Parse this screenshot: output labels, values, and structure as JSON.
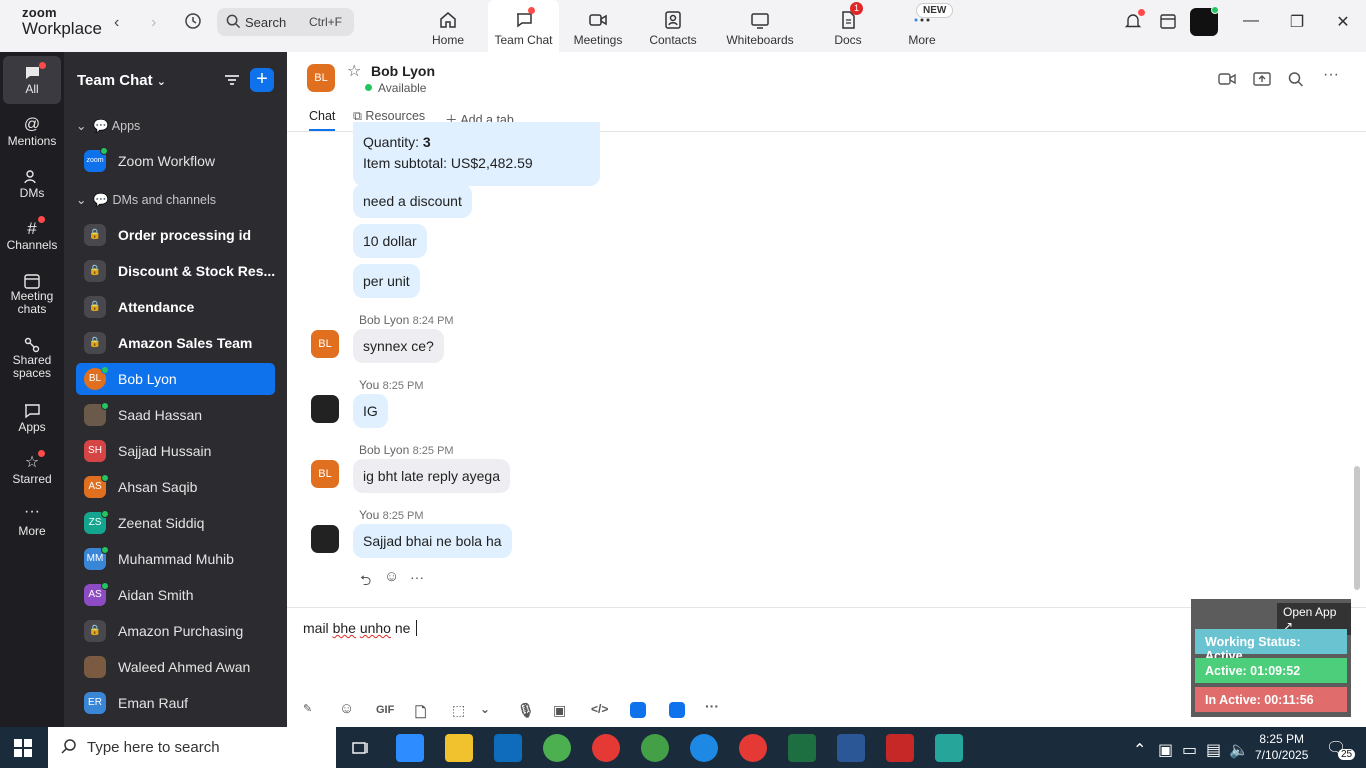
{
  "window": {
    "brand_line1": "zoom",
    "brand_line2": "Workplace",
    "search_label": "Search",
    "search_shortcut": "Ctrl+F"
  },
  "tabs": [
    {
      "label": "Home",
      "icon": "home-icon"
    },
    {
      "label": "Team Chat",
      "icon": "chat-icon",
      "active": true
    },
    {
      "label": "Meetings",
      "icon": "video-icon"
    },
    {
      "label": "Contacts",
      "icon": "contacts-icon"
    },
    {
      "label": "Whiteboards",
      "icon": "whiteboard-icon"
    },
    {
      "label": "Docs",
      "icon": "docs-icon",
      "badge": "1"
    },
    {
      "label": "More",
      "icon": "more-icon",
      "badge": "NEW"
    }
  ],
  "rail": [
    {
      "label": "All",
      "icon": "chat-bubble-icon",
      "active": true
    },
    {
      "label": "Mentions",
      "icon": "at-icon"
    },
    {
      "label": "DMs",
      "icon": "people-icon"
    },
    {
      "label": "Channels",
      "icon": "hash-icon"
    },
    {
      "label": "Meeting chats",
      "icon": "calendar-icon"
    },
    {
      "label": "Shared spaces",
      "icon": "shared-icon"
    },
    {
      "label": "Apps",
      "icon": "apps-icon"
    },
    {
      "label": "Starred",
      "icon": "star-icon"
    },
    {
      "label": "More",
      "icon": "ellipsis-icon"
    }
  ],
  "sidebar": {
    "title": "Team Chat",
    "sections": {
      "apps": "Apps",
      "dms": "DMs and channels"
    },
    "apps_items": [
      {
        "label": "Zoom Workflow",
        "avatar": "zoom"
      }
    ],
    "items": [
      {
        "label": "Order processing id",
        "avatar": "",
        "bold": true,
        "type": "lock"
      },
      {
        "label": "Discount & Stock Res...",
        "avatar": "",
        "bold": true,
        "type": "lock"
      },
      {
        "label": "Attendance",
        "avatar": "",
        "bold": true,
        "type": "lock"
      },
      {
        "label": "Amazon Sales Team",
        "avatar": "",
        "bold": true,
        "type": "lock"
      },
      {
        "label": "Bob Lyon",
        "avatar": "BL",
        "color": "#e07020",
        "selected": true
      },
      {
        "label": "Saad Hassan",
        "avatar": "",
        "color": "#6a5a4a"
      },
      {
        "label": "Sajjad Hussain",
        "avatar": "SH",
        "color": "#d64545"
      },
      {
        "label": "Ahsan Saqib",
        "avatar": "AS",
        "color": "#e07020"
      },
      {
        "label": "Zeenat Siddiq",
        "avatar": "ZS",
        "color": "#13a58d"
      },
      {
        "label": "Muhammad Muhib",
        "avatar": "MM",
        "color": "#3a86d6"
      },
      {
        "label": "Aidan Smith",
        "avatar": "AS",
        "color": "#8e4cc4"
      },
      {
        "label": "Amazon Purchasing",
        "avatar": "",
        "type": "lock"
      },
      {
        "label": "Waleed Ahmed Awan",
        "avatar": "",
        "color": "#7a5a40"
      },
      {
        "label": "Eman Rauf",
        "avatar": "ER",
        "color": "#3a86d6"
      }
    ]
  },
  "chat": {
    "contact_initials": "BL",
    "contact_name": "Bob Lyon",
    "status": "Available",
    "tabs": {
      "chat": "Chat",
      "resources": "Resources",
      "add_tab": "Add a tab"
    },
    "messages": {
      "partial_quantity_label": "Quantity:",
      "partial_quantity_value": "3",
      "partial_subtotal": "Item subtotal: US$2,482.59",
      "m1": "need a discount",
      "m2": "10 dollar",
      "m3": "per unit",
      "g1_sender": "Bob Lyon",
      "g1_time": "8:24 PM",
      "g1_text": "synnex ce?",
      "g2_sender": "You",
      "g2_time": "8:25 PM",
      "g2_text": "IG",
      "g3_sender": "Bob Lyon",
      "g3_time": "8:25 PM",
      "g3_text": "ig bht late reply ayega",
      "g4_sender": "You",
      "g4_time": "8:25 PM",
      "g4_text": "Sajjad bhai ne bola ha"
    },
    "composer_text_1": "mail ",
    "composer_text_2": "bhe",
    "composer_text_3": " ",
    "composer_text_4": "unho",
    "composer_text_5": " ne ",
    "gif_label": "GIF"
  },
  "widget": {
    "open_app": "Open App ↗",
    "working_status": "Working Status: Active",
    "active": "Active: 01:09:52",
    "inactive": "In Active: 00:11:56",
    "colors": {
      "status": "#6ac3d0",
      "active": "#4cce7a",
      "inactive": "#e06c6c"
    }
  },
  "taskbar": {
    "search_placeholder": "Type here to search",
    "time": "8:25 PM",
    "date": "7/10/2025",
    "notif_count": "25"
  }
}
